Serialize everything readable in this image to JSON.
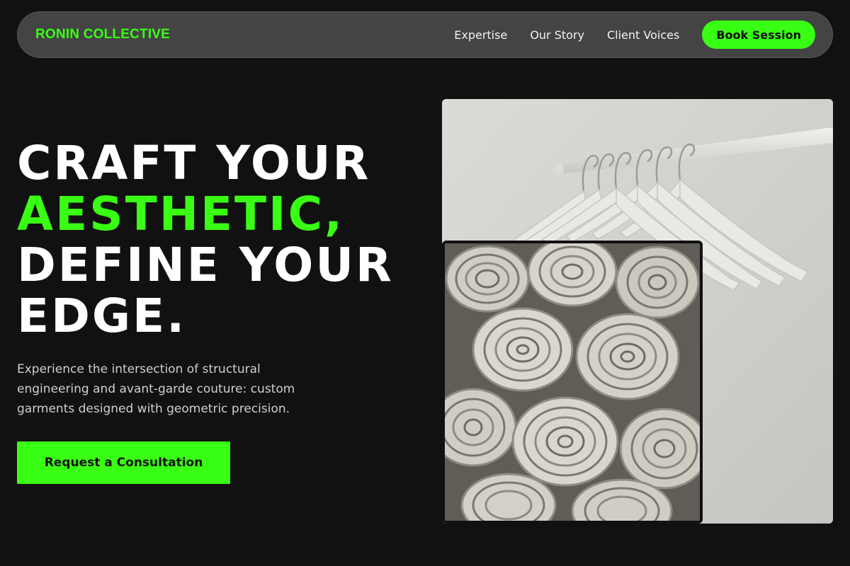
{
  "nav": {
    "brand": "RONIN COLLECTIVE",
    "links": [
      "Expertise",
      "Our Story",
      "Client Voices"
    ],
    "book_label": "Book Session"
  },
  "hero": {
    "title_line1": "CRAFT YOUR",
    "title_line2": "AESTHETIC,",
    "title_line3": "DEFINE YOUR",
    "title_line4": "EDGE.",
    "description": "Experience the intersection of structural engineering and avant-garde couture: custom garments designed with geometric precision.",
    "cta_label": "Request a Consultation"
  },
  "colors": {
    "accent": "#39ff14",
    "background": "#111111",
    "nav_bg": "#444444"
  },
  "images": {
    "back": "hangers-on-rack-photo",
    "front": "rolled-fabric-photo"
  }
}
